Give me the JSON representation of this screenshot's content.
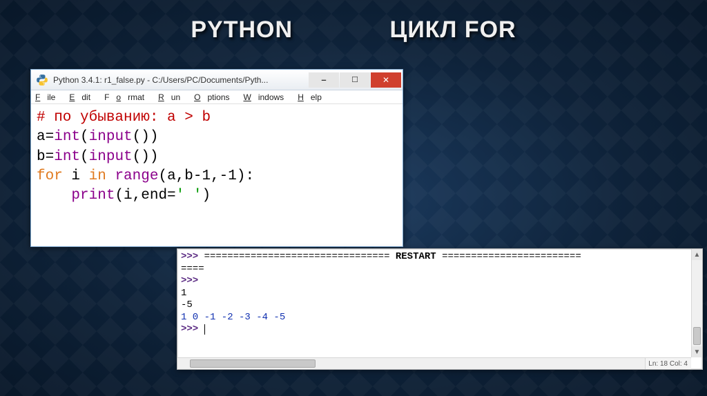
{
  "title": {
    "left": "PYTHON",
    "right": "ЦИКЛ FOR"
  },
  "editor_window": {
    "caption": "Python 3.4.1: r1_false.py - C:/Users/PC/Documents/Pyth...",
    "menu": {
      "file": {
        "mn": "F",
        "rest": "ile"
      },
      "edit": {
        "mn": "E",
        "rest": "dit"
      },
      "format": {
        "pre": "F",
        "mn": "o",
        "rest": "rmat"
      },
      "run": {
        "mn": "R",
        "rest": "un"
      },
      "options": {
        "mn": "O",
        "rest": "ptions"
      },
      "windows": {
        "mn": "W",
        "rest": "indows"
      },
      "help": {
        "mn": "H",
        "rest": "elp"
      }
    },
    "code": {
      "l1": "# по убыванию: a > b",
      "l2_a": "a=",
      "l2_fn": "int",
      "l2_b": "(",
      "l2_fn2": "input",
      "l2_c": "())",
      "l3_a": "b=",
      "l3_fn": "int",
      "l3_b": "(",
      "l3_fn2": "input",
      "l3_c": "())",
      "l4_kw": "for",
      "l4_a": " i ",
      "l4_kw2": "in",
      "l4_b": " ",
      "l4_fn": "range",
      "l4_c": "(a,b-1,-1):",
      "l5_pad": "    ",
      "l5_fn": "print",
      "l5_a": "(i,end=",
      "l5_str": "' '",
      "l5_b": ")"
    }
  },
  "shell": {
    "prompt": ">>>",
    "restart_label": "RESTART",
    "eqline_left": "================================",
    "eqline_right": "========================",
    "eq_wrap": "====",
    "input1": "1",
    "input2": "-5",
    "output": "1 0 -1 -2 -3 -4 -5",
    "status": "Ln: 18 Col: 4"
  }
}
